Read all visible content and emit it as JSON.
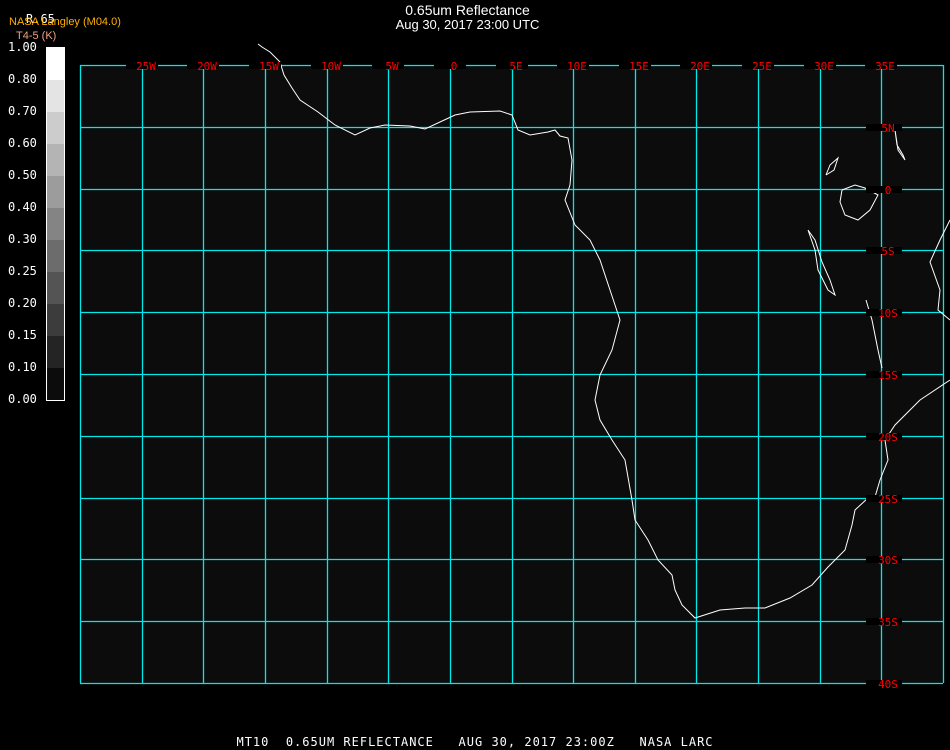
{
  "title": "0.65um Reflectance",
  "subtitle": "Aug 30, 2017 23:00 UTC",
  "organization": "NASA Langley (M04.0)",
  "band_label": "T4-5 (K)",
  "colorbar": {
    "label": "R.65",
    "ticks": [
      "1.00",
      "0.80",
      "0.70",
      "0.60",
      "0.50",
      "0.40",
      "0.30",
      "0.25",
      "0.20",
      "0.15",
      "0.10",
      "0.00"
    ],
    "colors": [
      "#ffffff",
      "#e4e4e4",
      "#cccccc",
      "#b4b4b4",
      "#9c9c9c",
      "#848484",
      "#6c6c6c",
      "#545454",
      "#3c3c3c",
      "#242424",
      "#0c0c0c"
    ]
  },
  "map": {
    "lon_labels": [
      "25W",
      "20W",
      "15W",
      "10W",
      "5W",
      "0",
      "5E",
      "10E",
      "15E",
      "20E",
      "25E",
      "30E",
      "35E"
    ],
    "lat_labels": [
      "5N",
      "0",
      "5S",
      "10S",
      "15S",
      "20S",
      "25S",
      "30S",
      "35S",
      "40S"
    ],
    "grid_color": "#00e8e8",
    "label_color": "#ff0000",
    "background": "#0c0c0c",
    "coast_color": "#ffffff"
  },
  "footer": "MT10  0.65UM REFLECTANCE   AUG 30, 2017 23:00Z   NASA LARC"
}
